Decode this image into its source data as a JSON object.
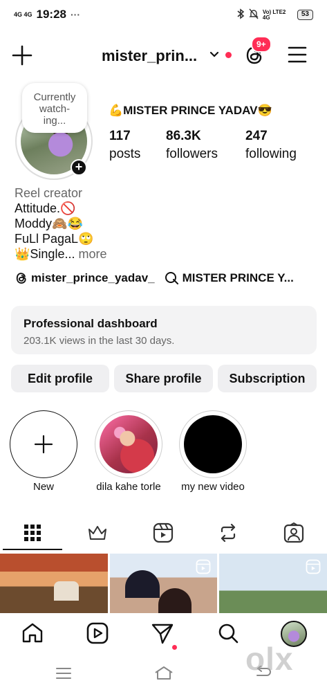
{
  "status_bar": {
    "time": "19:28",
    "left_net": "4G 4G",
    "ellipsis": "···",
    "net_right": "Vo) LTE2 4G",
    "battery": "53"
  },
  "header": {
    "username": "mister_prin...",
    "notif_badge": "9+"
  },
  "profile": {
    "bubble_line1": "Currently",
    "bubble_line2": "watch-",
    "bubble_line3": "ing...",
    "display_name": "💪MISTER PRINCE YADAV😎",
    "stats": [
      {
        "num": "117",
        "label": "posts"
      },
      {
        "num": "86.3K",
        "label": "followers"
      },
      {
        "num": "247",
        "label": "following"
      }
    ],
    "bio": {
      "category": "Reel creator",
      "line1": "Attitude.🚫",
      "line2": "Moddy🙈😂",
      "line3": "FuLl PagaL🙄",
      "line4": "👑Single...",
      "more": "more"
    },
    "links": [
      {
        "text": "mister_prince_yadav_",
        "icon": "threads-icon"
      },
      {
        "text": "MISTER PRINCE Y...",
        "icon": "channel-icon"
      }
    ]
  },
  "dashboard": {
    "title": "Professional dashboard",
    "subtitle": "203.1K views in the last 30 days."
  },
  "buttons": {
    "edit": "Edit profile",
    "share": "Share profile",
    "subscription": "Subscription"
  },
  "highlights": [
    {
      "label": "New"
    },
    {
      "label": "dila kahe torle"
    },
    {
      "label": "my new video"
    }
  ],
  "colors": {
    "accent_red": "#ff2d55",
    "button_bg": "#efeff1"
  },
  "watermark": "olx"
}
